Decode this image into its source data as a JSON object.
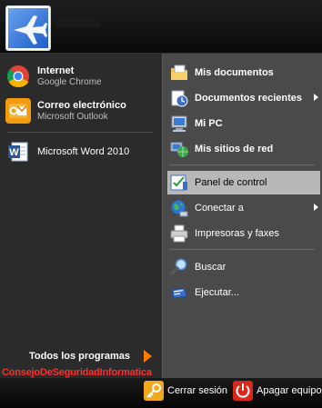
{
  "pinned": [
    {
      "title": "Internet",
      "subtitle": "Google Chrome",
      "icon": "chrome-icon"
    },
    {
      "title": "Correo electrónico",
      "subtitle": "Microsoft Outlook",
      "icon": "outlook-icon"
    }
  ],
  "recent": [
    {
      "title": "Microsoft Word 2010",
      "icon": "word-icon"
    }
  ],
  "all_programs": "Todos los programas",
  "watermark": "ConsejoDeSeguridadInformatica",
  "right_items": [
    {
      "label": "Mis documentos",
      "icon": "my-documents-icon",
      "bold": true,
      "submenu": false
    },
    {
      "label": "Documentos recientes",
      "icon": "recent-documents-icon",
      "bold": true,
      "submenu": true
    },
    {
      "label": "Mi PC",
      "icon": "my-computer-icon",
      "bold": true,
      "submenu": false
    },
    {
      "label": "Mis sitios de red",
      "icon": "network-places-icon",
      "bold": true,
      "submenu": false
    },
    {
      "label": "Panel de control",
      "icon": "control-panel-icon",
      "bold": false,
      "submenu": false,
      "selected": true
    },
    {
      "label": "Conectar a",
      "icon": "connect-to-icon",
      "bold": false,
      "submenu": true
    },
    {
      "label": "Impresoras y faxes",
      "icon": "printer-icon",
      "bold": false,
      "submenu": false
    },
    {
      "label": "Buscar",
      "icon": "search-icon",
      "bold": false,
      "submenu": false
    },
    {
      "label": "Ejecutar...",
      "icon": "run-icon",
      "bold": false,
      "submenu": false
    }
  ],
  "bottom": {
    "logoff": "Cerrar sesión",
    "shutdown": "Apagar equipo"
  },
  "colors": {
    "accent_arrow": "#ff7a00",
    "watermark": "#ff2d2d",
    "selected_bg": "#b8b8b8"
  }
}
